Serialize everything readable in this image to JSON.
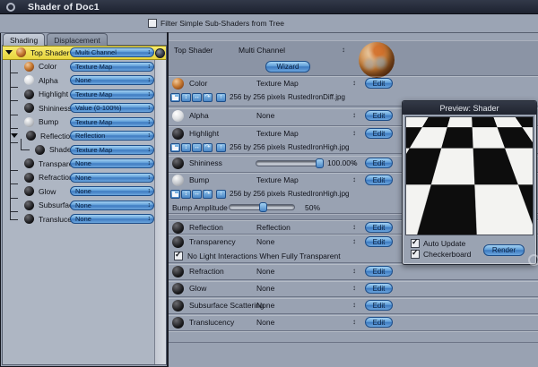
{
  "window": {
    "title": "Shader of Doc1"
  },
  "toolbar": {
    "filter_label": "Filter Simple Sub-Shaders from Tree",
    "filter_checked": false
  },
  "tabs": {
    "shading": "Shading",
    "displacement": "Displacement"
  },
  "tree": {
    "items": [
      {
        "label": "Top Shader",
        "value": "Multi Channel"
      },
      {
        "label": "Color",
        "value": "Texture Map"
      },
      {
        "label": "Alpha",
        "value": "None"
      },
      {
        "label": "Highlight",
        "value": "Texture Map"
      },
      {
        "label": "Shininess",
        "value": "Value (0-100%)"
      },
      {
        "label": "Bump",
        "value": "Texture Map"
      },
      {
        "label": "Reflection",
        "value": "Reflection"
      },
      {
        "label": "Shader",
        "value": "Texture Map"
      },
      {
        "label": "Transparency",
        "value": "None"
      },
      {
        "label": "Refraction",
        "value": "None"
      },
      {
        "label": "Glow",
        "value": "None"
      },
      {
        "label": "Subsurface Sc",
        "value": "None"
      },
      {
        "label": "Translucency",
        "value": "None"
      }
    ]
  },
  "detail": {
    "header": {
      "name": "Top Shader",
      "type": "Multi Channel",
      "wizard": "Wizard"
    },
    "rows": [
      {
        "name": "Color",
        "type": "Texture Map",
        "size": "256 by 256 pixels",
        "file": "RustedIronDiff.jpg",
        "edit": "Edit"
      },
      {
        "name": "Alpha",
        "type": "None",
        "edit": "Edit"
      },
      {
        "name": "Highlight",
        "type": "Texture Map",
        "size": "256 by 256 pixels",
        "file": "RustedIronHigh.jpg",
        "edit": "Edit"
      },
      {
        "name": "Shininess",
        "value": "100.00%",
        "edit": "Edit"
      },
      {
        "name": "Bump",
        "type": "Texture Map",
        "size": "256 by 256 pixels",
        "file": "RustedIronHigh.jpg",
        "amplitude_label": "Bump Amplitude",
        "amplitude_value": "50%",
        "edit": "Edit"
      },
      {
        "name": "Reflection",
        "type": "Reflection",
        "edit": "Edit"
      },
      {
        "name": "Transparency",
        "type": "None",
        "checkbox_label": "No Light Interactions When Fully Transparent",
        "checkbox_checked": true,
        "edit": "Edit"
      },
      {
        "name": "Refraction",
        "type": "None",
        "edit": "Edit"
      },
      {
        "name": "Glow",
        "type": "None",
        "edit": "Edit"
      },
      {
        "name": "Subsurface Scattering",
        "type": "None",
        "edit": "Edit"
      },
      {
        "name": "Translucency",
        "type": "None",
        "edit": "Edit"
      }
    ],
    "sliders": {
      "shininess_pct": 100,
      "bump_amplitude_pct": 50
    }
  },
  "preview": {
    "title": "Preview: Shader",
    "auto_update_label": "Auto Update",
    "auto_update_checked": true,
    "checkerboard_label": "Checkerboard",
    "checkerboard_checked": true,
    "render_label": "Render"
  },
  "colors": {
    "accent_blue": "#4a86c6",
    "selection_yellow": "#f2e250",
    "titlebar": "#232836",
    "panel_gray": "#99a2b2"
  }
}
